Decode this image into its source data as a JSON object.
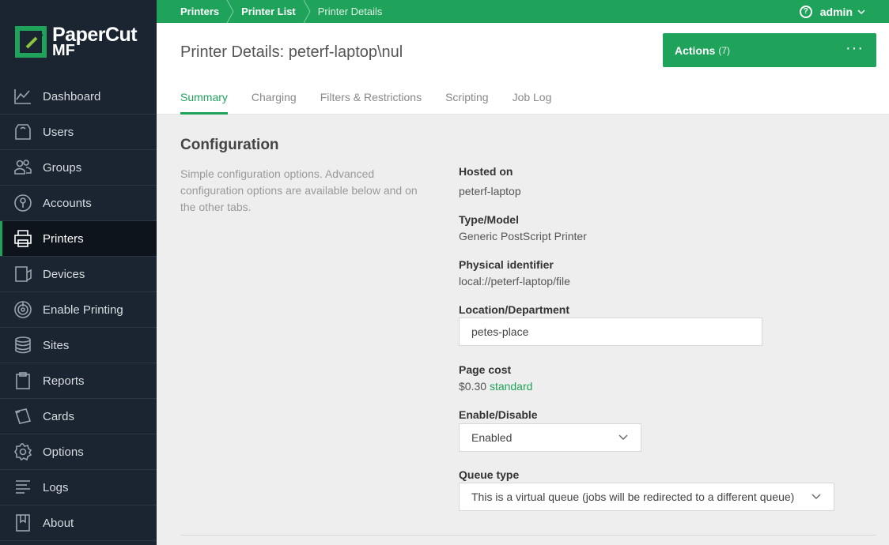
{
  "app": {
    "logo_name": "PaperCut",
    "logo_edition": "MF"
  },
  "sidebar": {
    "items": [
      {
        "label": "Dashboard",
        "icon": "chart-line-icon"
      },
      {
        "label": "Users",
        "icon": "user-icon"
      },
      {
        "label": "Groups",
        "icon": "users-icon"
      },
      {
        "label": "Accounts",
        "icon": "key-icon"
      },
      {
        "label": "Printers",
        "icon": "printer-icon",
        "active": true
      },
      {
        "label": "Devices",
        "icon": "device-icon"
      },
      {
        "label": "Enable Printing",
        "icon": "target-icon"
      },
      {
        "label": "Sites",
        "icon": "database-icon"
      },
      {
        "label": "Reports",
        "icon": "clipboard-icon"
      },
      {
        "label": "Cards",
        "icon": "cards-icon"
      },
      {
        "label": "Options",
        "icon": "gear-icon"
      },
      {
        "label": "Logs",
        "icon": "list-icon"
      },
      {
        "label": "About",
        "icon": "bookmark-icon"
      }
    ]
  },
  "topbar": {
    "breadcrumbs": [
      "Printers",
      "Printer List",
      "Printer Details"
    ],
    "user": "admin"
  },
  "header": {
    "title": "Printer Details: peterf-laptop\\nul",
    "actions_label": "Actions",
    "actions_count": "(7)",
    "actions_more": "···",
    "tabs": [
      "Summary",
      "Charging",
      "Filters & Restrictions",
      "Scripting",
      "Job Log"
    ],
    "active_tab": "Summary"
  },
  "config": {
    "title": "Configuration",
    "description": "Simple configuration options. Advanced configuration options are available below and on the other tabs.",
    "hosted_on_label": "Hosted on",
    "hosted_on_value": "peterf-laptop",
    "type_label": "Type/Model",
    "type_value": "Generic PostScript Printer",
    "physical_label": "Physical identifier",
    "physical_value": "local://peterf-laptop/file",
    "location_label": "Location/Department",
    "location_value": "petes-place",
    "page_cost_label": "Page cost",
    "page_cost_value": "$0.30",
    "page_cost_link": "standard",
    "enable_label": "Enable/Disable",
    "enable_value": "Enabled",
    "queue_label": "Queue type",
    "queue_value": "This is a virtual queue (jobs will be redirected to a different queue)"
  },
  "colors": {
    "brand_green": "#1fa35a",
    "sidebar_bg": "#1b2431"
  }
}
